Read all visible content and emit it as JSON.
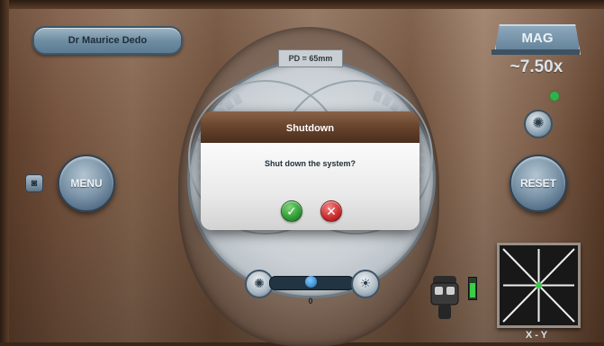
{
  "header": {
    "user_name": "Dr Maurice Dedo"
  },
  "magnification": {
    "label": "MAG",
    "value": "~7.50x"
  },
  "controls": {
    "menu_label": "MENU",
    "reset_label": "RESET",
    "pd_label": "PD = 65mm",
    "slider_value": "0",
    "slider_level": 0.5,
    "xy_label": "X - Y"
  },
  "dialog": {
    "title": "Shutdown",
    "message": "Shut down the system?",
    "confirm_icon": "check-icon",
    "cancel_icon": "x-icon"
  },
  "colors": {
    "confirm": "#2f9b34",
    "cancel": "#cc2b2b",
    "status_dot": "#2db34a",
    "ring_segments": "#1e6aa3"
  }
}
